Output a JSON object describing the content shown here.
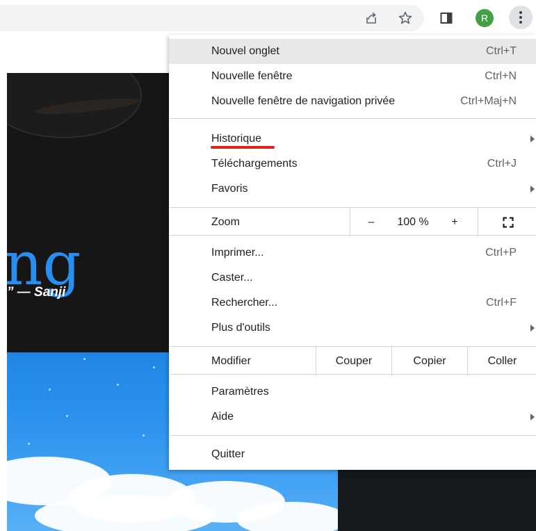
{
  "avatar": {
    "initial": "R",
    "color": "#43a047"
  },
  "background": {
    "hero_word": "ng",
    "quote": "” — Sanji"
  },
  "icons": [
    "share-icon",
    "star-icon",
    "side-panel-icon",
    "more-vert-icon",
    "fullscreen-icon",
    "submenu-arrow-icon"
  ],
  "menu": {
    "new_tab": {
      "label": "Nouvel onglet",
      "shortcut": "Ctrl+T"
    },
    "new_window": {
      "label": "Nouvelle fenêtre",
      "shortcut": "Ctrl+N"
    },
    "incognito": {
      "label": "Nouvelle fenêtre de navigation privée",
      "shortcut": "Ctrl+Maj+N"
    },
    "history": {
      "label": "Historique"
    },
    "downloads": {
      "label": "Téléchargements",
      "shortcut": "Ctrl+J"
    },
    "bookmarks": {
      "label": "Favoris"
    },
    "zoom": {
      "label": "Zoom",
      "minus": "–",
      "value": "100 %",
      "plus": "+"
    },
    "print": {
      "label": "Imprimer...",
      "shortcut": "Ctrl+P"
    },
    "cast": {
      "label": "Caster..."
    },
    "find": {
      "label": "Rechercher...",
      "shortcut": "Ctrl+F"
    },
    "more_tools": {
      "label": "Plus d'outils"
    },
    "edit": {
      "label": "Modifier",
      "cut": "Couper",
      "copy": "Copier",
      "paste": "Coller"
    },
    "settings": {
      "label": "Paramètres"
    },
    "help": {
      "label": "Aide"
    },
    "quit": {
      "label": "Quitter"
    }
  },
  "colors": {
    "highlight_underline": "#e0201b",
    "hover_row": "#e8e8e8"
  }
}
